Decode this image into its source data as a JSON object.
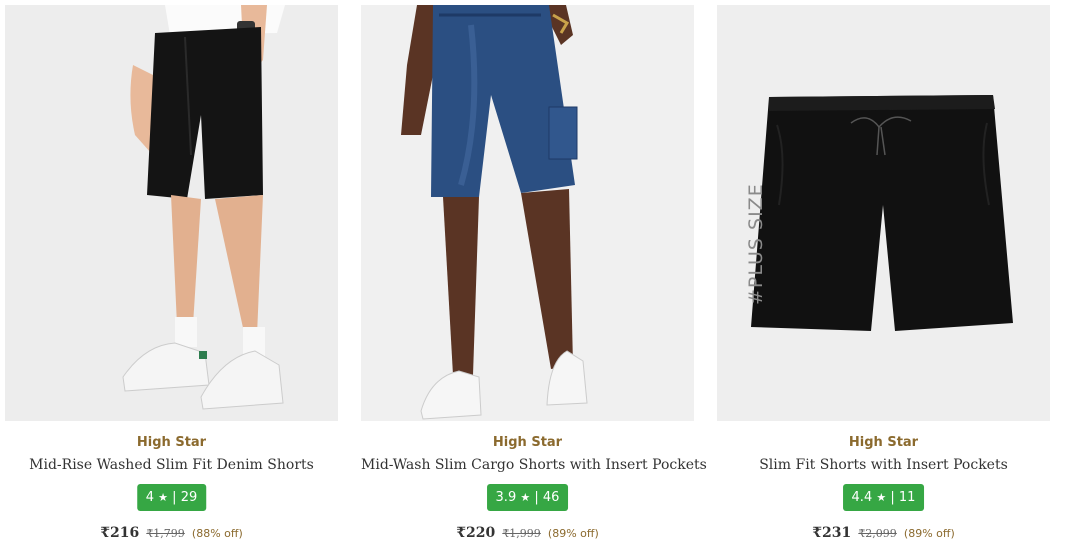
{
  "products": [
    {
      "brand": "High Star",
      "title": "Mid-Rise Washed Slim Fit Denim Shorts",
      "rating": "4",
      "rating_count": "29",
      "price": "₹216",
      "mrp": "₹1,799",
      "discount": "(88% off)",
      "image": "model-wearing-black-denim-shorts"
    },
    {
      "brand": "High Star",
      "title": "Mid-Wash Slim Cargo Shorts with Insert Pockets",
      "rating": "3.9",
      "rating_count": "46",
      "price": "₹220",
      "mrp": "₹1,999",
      "discount": "(89% off)",
      "image": "model-wearing-blue-cargo-shorts"
    },
    {
      "brand": "High Star",
      "title": "Slim Fit Shorts with Insert Pockets",
      "rating": "4.4",
      "rating_count": "11",
      "price": "₹231",
      "mrp": "₹2,099",
      "discount": "(89% off)",
      "image": "black-shorts-flatlay",
      "image_tag": "#PLUS SIZE"
    }
  ],
  "rating_star": "★",
  "rating_separator": "|",
  "colors": {
    "brand": "#8b6a2e",
    "rating_bg": "#36a744",
    "discount": "#8b6a2e",
    "image_bg": "#ececec"
  }
}
